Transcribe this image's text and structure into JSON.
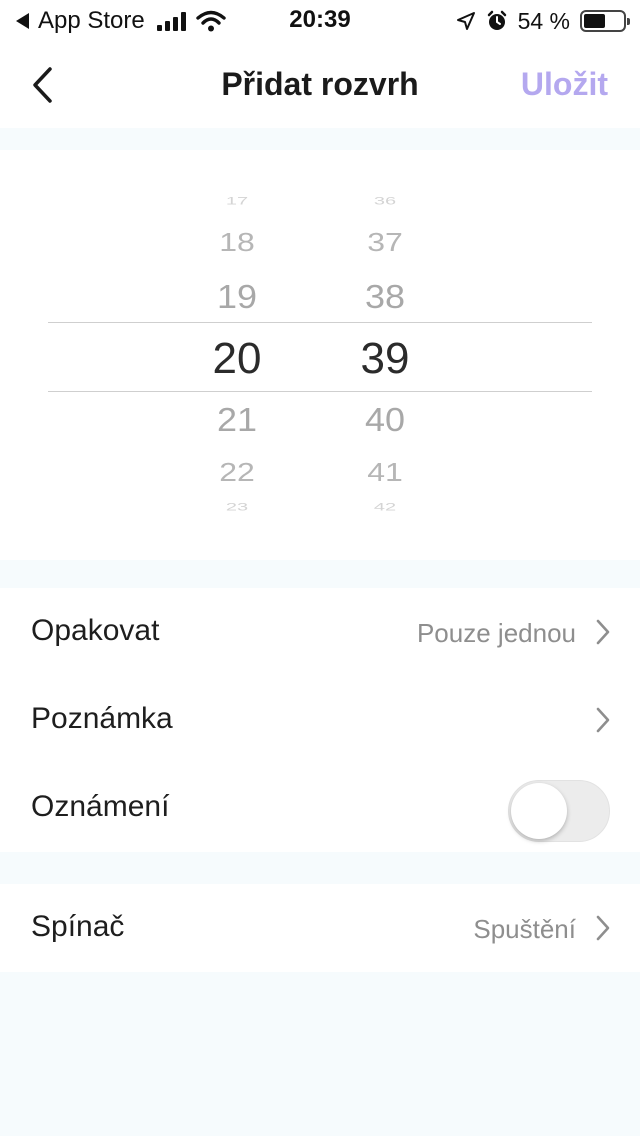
{
  "status_bar": {
    "back_app": "App Store",
    "time": "20:39",
    "battery_text": "54 %",
    "battery_level": 0.54,
    "icons": [
      "back-triangle-icon",
      "cellular-signal-icon",
      "wifi-icon",
      "location-arrow-icon",
      "alarm-clock-icon",
      "battery-icon"
    ]
  },
  "nav": {
    "back_icon": "chevron-left-icon",
    "title": "Přidat rozvrh",
    "save_label": "Uložit",
    "save_color": "#b4a8ef"
  },
  "picker": {
    "hours": [
      "17",
      "18",
      "19",
      "20",
      "21",
      "22",
      "23"
    ],
    "minutes": [
      "36",
      "37",
      "38",
      "39",
      "40",
      "41",
      "42"
    ],
    "selected_hour": "20",
    "selected_minute": "39"
  },
  "settings": [
    {
      "label": "Opakovat",
      "value": "Pouze jednou",
      "chevron": true
    },
    {
      "label": "Poznámka",
      "value": "",
      "chevron": true
    },
    {
      "label": "Oznámení",
      "toggle": false
    }
  ],
  "switch_group": [
    {
      "label": "Spínač",
      "value": "Spuštění",
      "chevron": true
    }
  ],
  "colors": {
    "page_background": "#f6fbfd",
    "accent": "#b4a8ef"
  }
}
